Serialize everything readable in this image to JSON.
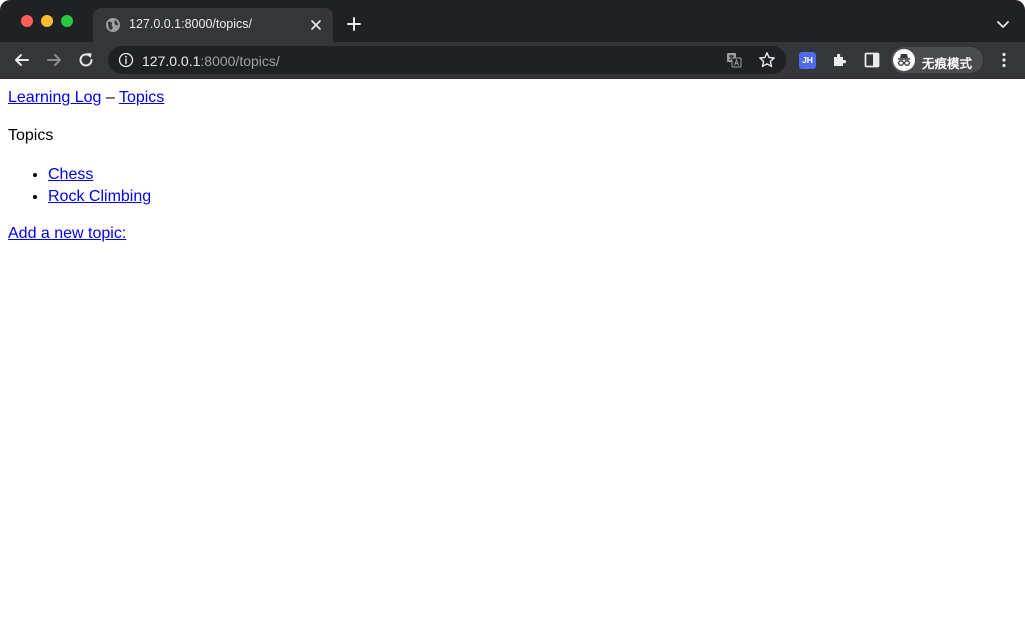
{
  "browser": {
    "tab": {
      "title": "127.0.0.1:8000/topics/",
      "icon": "globe-icon"
    },
    "address_bar": {
      "host": "127.0.0.1",
      "path": ":8000/topics/"
    },
    "profile": {
      "label": "无痕模式",
      "icon": "incognito-icon"
    },
    "extension_badge": "JH",
    "colors": {
      "tabstrip": "#202124",
      "toolbar": "#35363a",
      "link": "#0000ee"
    }
  },
  "page": {
    "nav": {
      "home_link": "Learning Log",
      "separator": "–",
      "topics_link": "Topics"
    },
    "heading": "Topics",
    "topics": [
      "Chess",
      "Rock Climbing"
    ],
    "add_link": "Add a new topic:"
  }
}
